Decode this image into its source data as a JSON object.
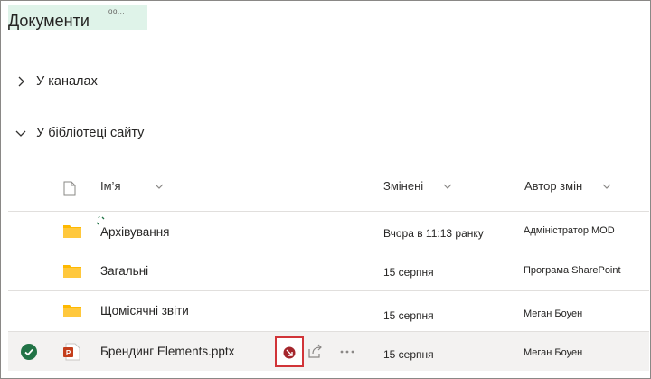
{
  "page": {
    "title": "Документи",
    "title_tag": "οο..."
  },
  "sections": [
    {
      "label": "У каналах"
    },
    {
      "label": "У бібліотеці сайту"
    }
  ],
  "columns": {
    "name": "Ім’я",
    "modified": "Змінені",
    "author": "Автор змін"
  },
  "rows": [
    {
      "name": "Архівування",
      "modified": "Вчора в 11:13 ранку",
      "author": "Адміністратор MOD",
      "type": "folder"
    },
    {
      "name": "Загальні",
      "modified": "15 серпня",
      "author": "Програма SharePoint",
      "type": "folder"
    },
    {
      "name": "Щомісячні звіти",
      "modified": "15 серпня",
      "author": "Меган Боуен",
      "type": "folder"
    },
    {
      "name": "Брендинг Elements.pptx",
      "modified": "15 серпня",
      "author": "Меган Боуен",
      "type": "pptx",
      "selected": true
    }
  ],
  "colors": {
    "accent": "#217346",
    "ppt": "#c43e1c",
    "folder": "#ffb900",
    "highlight_box": "#d13438"
  },
  "icons": {
    "doc_header": "document-icon",
    "folder": "folder-icon",
    "pptx": "powerpoint-icon",
    "check": "checkmark-circle-icon",
    "share": "share-icon",
    "more": "more-icon",
    "sync": "sync-icon"
  }
}
